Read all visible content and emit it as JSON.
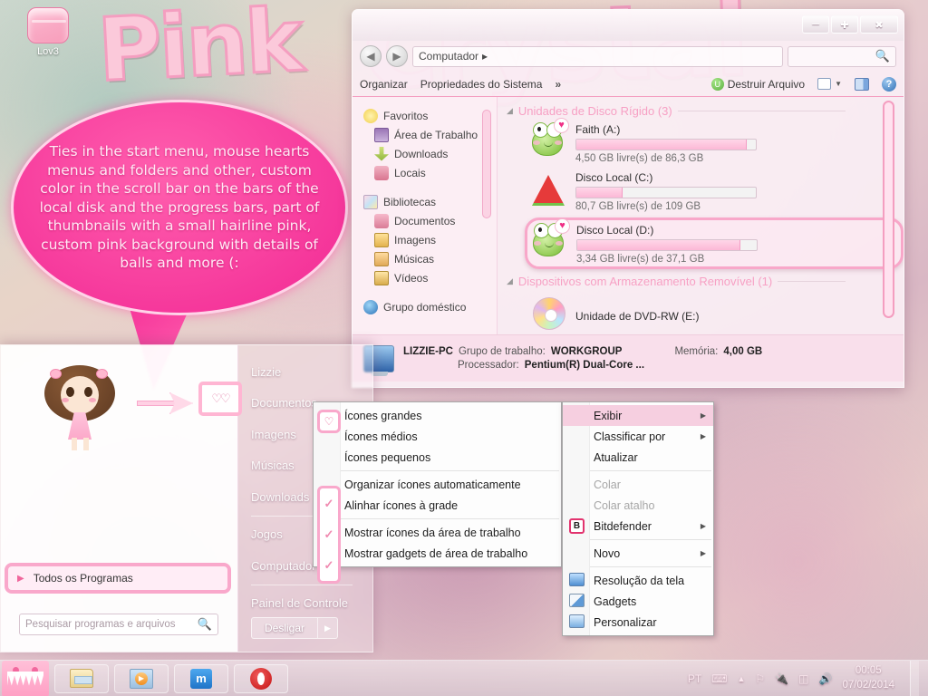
{
  "desktop": {
    "icon": {
      "label": "Lov3",
      "icon": "pink-folder-icon"
    },
    "wordart": {
      "line1": "Pink",
      "line2": "Crystal"
    },
    "bubble_text": "Ties in the start menu, mouse hearts menus and folders and other, custom color  in the scroll bar on the bars of the local  disk and the progress bars, part of thumbnails with a small hairline pink, custom  pink background  with details of balls and more (:"
  },
  "explorer": {
    "titlebar": {
      "minimize": "─",
      "maximize": "✚",
      "close": "✖"
    },
    "address": {
      "back": "◀",
      "forward": "▶",
      "crumb": "Computador",
      "crumb_arrow": "▸",
      "search_icon": "search-icon"
    },
    "toolbar": {
      "organize": "Organizar",
      "system_properties": "Propriedades do Sistema",
      "overflow": "»",
      "destroy_file": "Destruir Arquivo",
      "destroy_badge": "U",
      "view_icon": "view-options-icon",
      "view_arrow": "▼",
      "preview_pane": "preview-pane-icon",
      "help": "?"
    },
    "nav": {
      "favorites": {
        "label": "Favoritos",
        "icon": "star-icon"
      },
      "favorites_items": [
        {
          "label": "Área de Trabalho",
          "icon": "desktop-icon"
        },
        {
          "label": "Downloads",
          "icon": "download-arrow-icon"
        },
        {
          "label": "Locais",
          "icon": "recent-places-icon"
        }
      ],
      "libraries": {
        "label": "Bibliotecas",
        "icon": "libraries-icon"
      },
      "libraries_items": [
        {
          "label": "Documentos",
          "icon": "documents-icon"
        },
        {
          "label": "Imagens",
          "icon": "pictures-icon"
        },
        {
          "label": "Músicas",
          "icon": "music-icon"
        },
        {
          "label": "Vídeos",
          "icon": "videos-icon"
        }
      ],
      "homegroup": {
        "label": "Grupo doméstico",
        "icon": "homegroup-icon"
      }
    },
    "groups": [
      {
        "title": "Unidades de Disco Rígido (3)",
        "collapse": "◢"
      },
      {
        "title": "Dispositivos com Armazenamento Removível (1)",
        "collapse": "◢"
      }
    ],
    "drives": [
      {
        "name": "Faith (A:)",
        "free_text": "4,50 GB livre(s) de 86,3 GB",
        "fill_percent": 95,
        "icon": "frog-drive-icon",
        "selected": false
      },
      {
        "name": "Disco Local (C:)",
        "free_text": "80,7 GB livre(s) de 109 GB",
        "fill_percent": 26,
        "icon": "watermelon-drive-icon",
        "selected": false
      },
      {
        "name": "Disco Local (D:)",
        "free_text": "3,34 GB livre(s) de 37,1 GB",
        "fill_percent": 91,
        "icon": "frog-drive-icon",
        "selected": true
      }
    ],
    "removable": [
      {
        "name": "Unidade de DVD-RW (E:)",
        "icon": "cd-drive-icon"
      }
    ],
    "status": {
      "pc_name": "LIZZIE-PC",
      "workgroup_label": "Grupo de trabalho:",
      "workgroup_value": "WORKGROUP",
      "memory_label": "Memória:",
      "memory_value": "4,00 GB",
      "processor_label": "Processador:",
      "processor_value": "Pentium(R) Dual-Core ..."
    }
  },
  "start_menu": {
    "right_items": [
      {
        "label": "Lizzie"
      },
      {
        "label": "Documentos"
      },
      {
        "label": "Imagens"
      },
      {
        "label": "Músicas"
      },
      {
        "label": "Downloads"
      },
      {
        "label": "Jogos"
      },
      {
        "label": "Computador"
      },
      {
        "label": "Painel de Controle"
      }
    ],
    "all_programs": {
      "label": "Todos os Programas",
      "arrow": "▶"
    },
    "search_placeholder": "Pesquisar programas e arquivos",
    "shutdown": {
      "label": "Desligar",
      "arrow": "▶"
    }
  },
  "context_menu": {
    "items": [
      {
        "label": "Exibir",
        "arrow": "▶",
        "highlighted": true,
        "icon": ""
      },
      {
        "label": "Classificar por",
        "arrow": "▶",
        "highlighted": false,
        "icon": ""
      },
      {
        "label": "Atualizar",
        "arrow": "",
        "highlighted": false,
        "icon": ""
      },
      {
        "separator": true
      },
      {
        "label": "Colar",
        "arrow": "",
        "disabled": true,
        "icon": ""
      },
      {
        "label": "Colar atalho",
        "arrow": "",
        "disabled": true,
        "icon": ""
      },
      {
        "label": "Bitdefender",
        "arrow": "▶",
        "icon": "bitdefender-icon",
        "icon_text": "B"
      },
      {
        "separator": true
      },
      {
        "label": "Novo",
        "arrow": "▶",
        "icon": ""
      },
      {
        "separator": true
      },
      {
        "label": "Resolução da tela",
        "arrow": "",
        "icon": "screen-resolution-icon"
      },
      {
        "label": "Gadgets",
        "arrow": "",
        "icon": "gadgets-icon"
      },
      {
        "label": "Personalizar",
        "arrow": "",
        "icon": "personalize-icon"
      }
    ]
  },
  "view_submenu": {
    "items": [
      {
        "label": "Ícones grandes"
      },
      {
        "label": "Ícones médios"
      },
      {
        "label": "Ícones pequenos"
      },
      {
        "separator": true
      },
      {
        "label": "Organizar ícones automaticamente"
      },
      {
        "label": "Alinhar ícones à grade"
      },
      {
        "separator": true
      },
      {
        "label": "Mostrar ícones da área de trabalho"
      },
      {
        "label": "Mostrar gadgets de área de trabalho"
      }
    ],
    "heart_marker": "♡",
    "checks": [
      "✓",
      "✓",
      "✓"
    ]
  },
  "taskbar": {
    "start_orb": "domo-start-icon",
    "buttons": [
      {
        "icon": "windows-explorer-icon"
      },
      {
        "icon": "media-player-icon"
      },
      {
        "icon": "maxthon-icon",
        "glyph": "m"
      },
      {
        "icon": "opera-icon",
        "glyph": "O"
      }
    ],
    "tray": {
      "language": "PT",
      "icons": [
        "keyboard-icon",
        "show-hidden-icons-icon",
        "action-center-flag-icon",
        "power-plug-icon",
        "network-bars-icon",
        "volume-speaker-icon"
      ],
      "time": "00:05",
      "date": "07/02/2014"
    }
  }
}
